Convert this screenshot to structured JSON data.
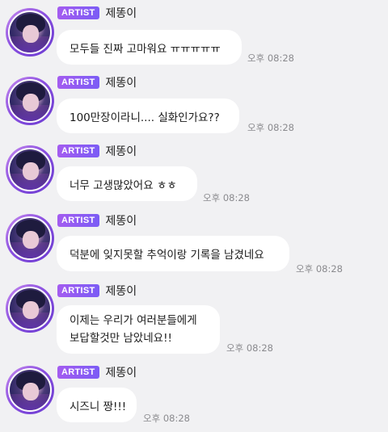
{
  "messages": [
    {
      "badge": "ARTIST",
      "sender": "제똥이",
      "lines": [
        "모두들 진짜 고마워요 ㅠㅠㅠㅠㅠ"
      ],
      "time": "오후 08:28"
    },
    {
      "badge": "ARTIST",
      "sender": "제똥이",
      "lines": [
        "100만장이라니.... 실화인가요??"
      ],
      "time": "오후 08:28"
    },
    {
      "badge": "ARTIST",
      "sender": "제똥이",
      "lines": [
        "너무 고생많았어요 ㅎㅎ"
      ],
      "time": "오후 08:28"
    },
    {
      "badge": "ARTIST",
      "sender": "제똥이",
      "lines": [
        "덕분에 잊지못할 추억이랑 기록을 남겼네요"
      ],
      "time": "오후 08:28"
    },
    {
      "badge": "ARTIST",
      "sender": "제똥이",
      "lines": [
        "이제는 우리가 여러분들에게",
        "보답할것만 남았네요!!"
      ],
      "time": "오후 08:28"
    },
    {
      "badge": "ARTIST",
      "sender": "제똥이",
      "lines": [
        "시즈니 짱!!!"
      ],
      "time": "오후 08:28"
    }
  ]
}
